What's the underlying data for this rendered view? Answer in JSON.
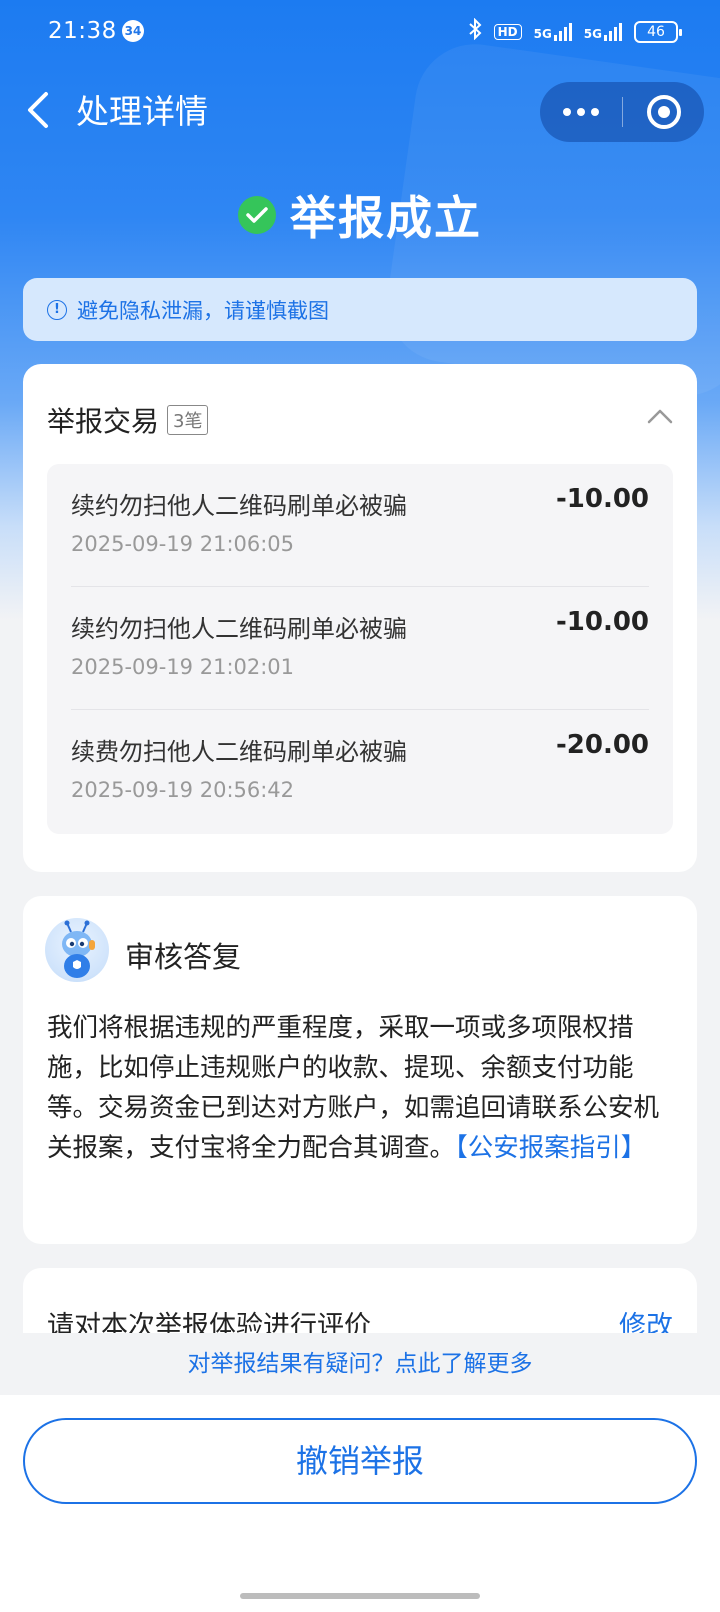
{
  "status_bar": {
    "time": "21:38",
    "notification_count": "34",
    "hd_label": "HD",
    "network1": "5G",
    "network2": "5G",
    "battery": "46"
  },
  "nav": {
    "title": "处理详情",
    "back_icon": "chevron-left-icon",
    "more_icon": "more-dots-icon",
    "close_icon": "target-ring-icon"
  },
  "result": {
    "status": "举报成立",
    "icon": "check-circle-icon",
    "icon_color": "#35c55a"
  },
  "notice": {
    "text": "避免隐私泄漏，请谨慎截图"
  },
  "transactions": {
    "title": "举报交易",
    "count_badge": "3笔",
    "items": [
      {
        "name": "续约勿扫他人二维码刷单必被骗",
        "amount": "-10.00",
        "time": "2025-09-19 21:06:05"
      },
      {
        "name": "续约勿扫他人二维码刷单必被骗",
        "amount": "-10.00",
        "time": "2025-09-19 21:02:01"
      },
      {
        "name": "续费勿扫他人二维码刷单必被骗",
        "amount": "-20.00",
        "time": "2025-09-19 20:56:42"
      }
    ]
  },
  "review": {
    "title": "审核答复",
    "body": "我们将根据违规的严重程度，采取一项或多项限权措施，比如停止违规账户的收款、提现、余额支付功能等。交易资金已到达对方账户，如需追回请联系公安机关报案，支付宝将全力配合其调查。",
    "link": "【公安报案指引】"
  },
  "rating": {
    "prompt": "请对本次举报体验进行评价",
    "edit": "修改"
  },
  "footer": {
    "doubt_link": "对举报结果有疑问？点此了解更多",
    "cancel_button": "撤销举报"
  },
  "colors": {
    "accent": "#1c72e6",
    "header_blue": "#1c7bf1",
    "success": "#35c55a"
  }
}
